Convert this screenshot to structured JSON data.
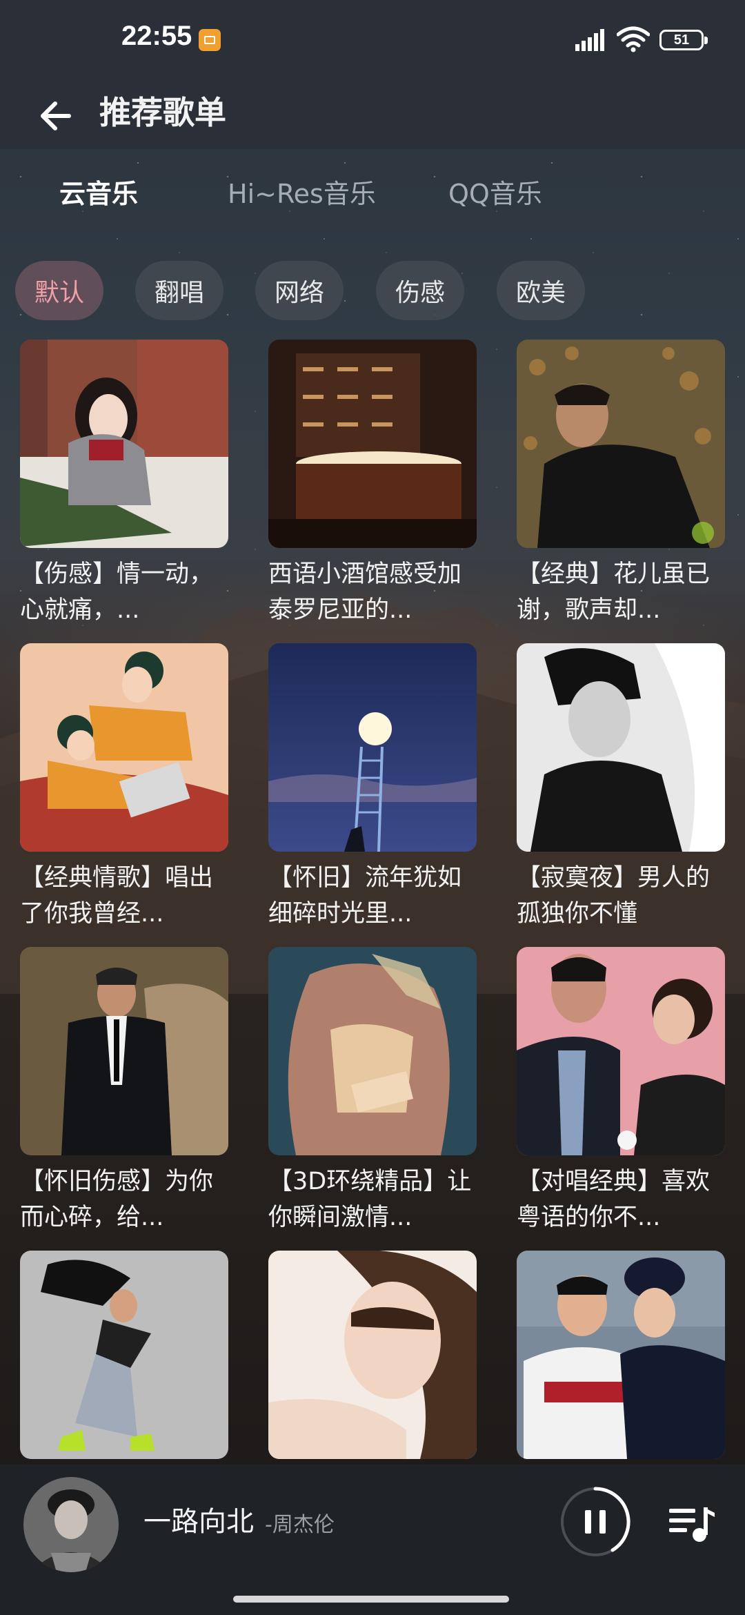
{
  "status_bar": {
    "time": "22:55",
    "battery_level": "51"
  },
  "header": {
    "title": "推荐歌单",
    "back_icon": "arrow-left-icon"
  },
  "tabs": [
    {
      "label": "云音乐",
      "active": true
    },
    {
      "label": "Hi~Res音乐",
      "active": false
    },
    {
      "label": "QQ音乐",
      "active": false
    }
  ],
  "chips": [
    {
      "label": "默认",
      "active": true
    },
    {
      "label": "翻唱",
      "active": false
    },
    {
      "label": "网络",
      "active": false
    },
    {
      "label": "伤感",
      "active": false
    },
    {
      "label": "欧美",
      "active": false
    }
  ],
  "playlists": [
    {
      "title": "【伤感】情一动，心就痛，..."
    },
    {
      "title": "西语小酒馆感受加泰罗尼亚的..."
    },
    {
      "title": "【经典】花儿虽已谢，歌声却..."
    },
    {
      "title": "【经典情歌】唱出了你我曾经..."
    },
    {
      "title": "【怀旧】流年犹如细碎时光里..."
    },
    {
      "title": "【寂寞夜】男人的孤独你不懂"
    },
    {
      "title": "【怀旧伤感】为你而心碎，给..."
    },
    {
      "title": "【3D环绕精品】让你瞬间激情..."
    },
    {
      "title": "【对唱经典】喜欢粤语的你不..."
    },
    {
      "title": ""
    },
    {
      "title": ""
    },
    {
      "title": ""
    }
  ],
  "player": {
    "song": "一路向北",
    "artist": "-周杰伦",
    "state_icon": "pause-icon",
    "queue_icon": "playlist-icon"
  },
  "colors": {
    "accent_chip_text": "#f0a0aa",
    "bar_background": "#2b2f38",
    "player_background": "#1f2227"
  }
}
